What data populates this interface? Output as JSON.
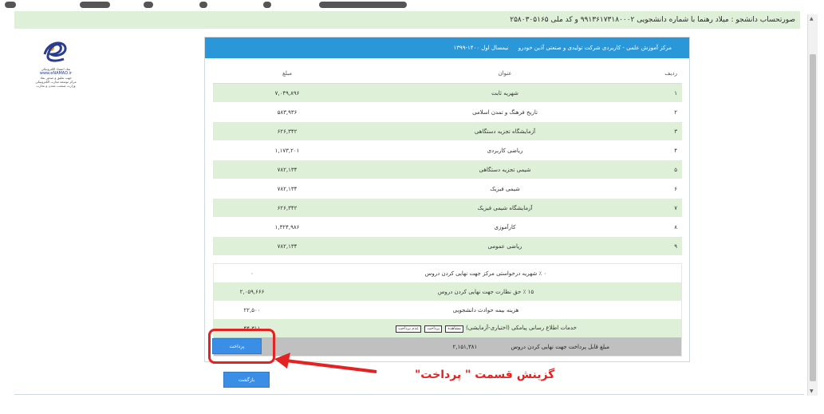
{
  "banner_text": "صورتحساب دانشجو : میلاد رهنما با شماره دانشجویی ۹۹۱۳۶۱۷۳۱۸۰۰۰۲ و کد ملی ۲۵۸۰۳۰۵۱۶۵",
  "enamad": {
    "label_top": "نماد اعتماد الکترونیکی",
    "url": "www.eNAMAD.ir",
    "label_mid": "جهت تعلیق و صدور نماد",
    "label_org": "مرکز توسعه تجارت الکترونیکی",
    "label_bottom": "وزارت صنعت، معدن و تجارت"
  },
  "panel": {
    "center": "مرکز آموزش علمی - کاربردی شرکت تولیدی و صنعتی آذین خودرو",
    "term": "نیمسال اول ۱۴۰۰-۱۳۹۹"
  },
  "table": {
    "headers": {
      "num": "ردیف",
      "title": "عنوان",
      "amount": "مبلغ"
    },
    "rows": [
      {
        "num": "۱",
        "title": "شهریه ثابت",
        "amount": "۷,۰۴۹,۸۹۶"
      },
      {
        "num": "۲",
        "title": "تاریخ فرهنگ و تمدن اسلامی",
        "amount": "۵۸۳,۹۳۶"
      },
      {
        "num": "۳",
        "title": "آزمایشگاه تجزیه دستگاهی",
        "amount": "۶۲۶,۳۴۲"
      },
      {
        "num": "۴",
        "title": "ریاضی کاربردی",
        "amount": "۱,۱۷۳,۲۰۱"
      },
      {
        "num": "۵",
        "title": "شیمی تجزیه دستگاهی",
        "amount": "۷۸۲,۱۳۴"
      },
      {
        "num": "۶",
        "title": "شیمی فیزیک",
        "amount": "۷۸۲,۱۳۴"
      },
      {
        "num": "۷",
        "title": "آزمایشگاه شیمی فیزیک",
        "amount": "۶۲۶,۳۴۲"
      },
      {
        "num": "۸",
        "title": "کارآموزی",
        "amount": "۱,۳۲۴,۹۸۶"
      },
      {
        "num": "۹",
        "title": "ریاضی عمومی",
        "amount": "۷۸۲,۱۳۴"
      }
    ]
  },
  "summary": {
    "rows": [
      {
        "label": "۰ ٪ شهریه درخواستی مرکز جهت نهایی کردن دروس",
        "value": "۰"
      },
      {
        "label": "۱۵ ٪ حق نظارت جهت نهایی کردن دروس",
        "value": "۲,۰۵۹,۶۶۶"
      },
      {
        "label": "هزینه بیمه حوادث دانشجویی",
        "value": "۲۲,۵۰۰"
      },
      {
        "label": "خدمات اطلاع رسانی پیامکی (اختیاری-آزمایشی)",
        "value": "۴۴,۳۱۱",
        "options": [
          "مشاهده",
          "پرداخت",
          "عدم پرداخت"
        ]
      }
    ],
    "total_label": "مبلغ قابل پرداخت جهت نهایی کردن دروس",
    "total_value": "۲,۱۵۱,۳۸۱"
  },
  "buttons": {
    "pay": "پرداخت",
    "back": "بازگشت"
  },
  "annotation": "گزینش قسمت \" پرداخت\"",
  "colors": {
    "header_blue": "#2a98d8",
    "row_green": "#dff0d8",
    "highlight_red": "#e32222",
    "button_blue": "#3a8ee6"
  }
}
